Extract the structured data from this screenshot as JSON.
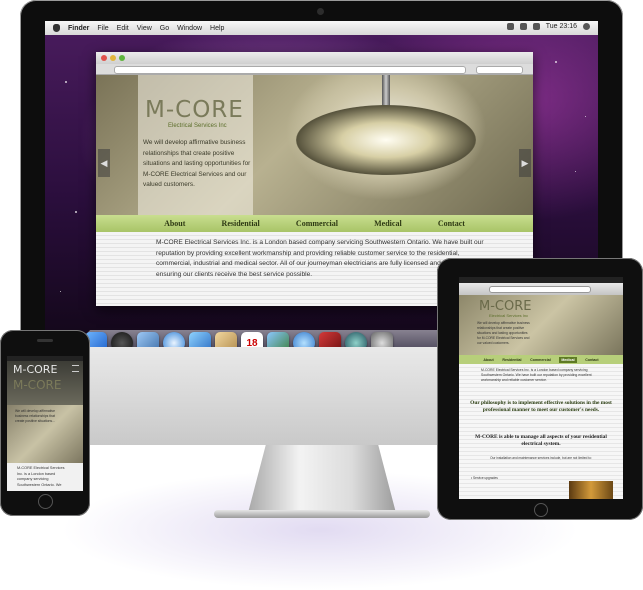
{
  "menubar": {
    "app": "Finder",
    "items": [
      "File",
      "Edit",
      "View",
      "Go",
      "Window",
      "Help"
    ],
    "clock": "Tue 23:16"
  },
  "site": {
    "logo": "M-CORE",
    "logo_subtitle": "Electrical Services Inc",
    "hero_text": "We will develop affirmative business relationships that create positive situations and lasting opportunities for M-CORE Electrical Services and our valued customers.",
    "nav": [
      "About",
      "Residential",
      "Commercial",
      "Medical",
      "Contact"
    ],
    "intro": "M-CORE Electrical Services Inc. is a London based company servicing Southwestern Ontario. We have built our reputation by providing excellent workmanship and providing reliable customer service to the residential, commercial, industrial and medical sector. All of our journeyman electricians are fully licensed and insured, ensuring our clients receive the best service possible."
  },
  "ipad": {
    "active_nav": "Medical",
    "intro_short": "M-CORE Electrical Services Inc. is a London based company servicing Southwestern Ontario. We have built our reputation by providing excellent workmanship and reliable customer service.",
    "philosophy": "Our philosophy is to implement effective solutions in the most professional manner to meet our customer's needs.",
    "ability": "M-CORE is able to manage all aspects of your residential electrical system.",
    "services_note": "Our installation and maintenance services include, but are not limited to:",
    "service_item": "• Service upgrades"
  },
  "iphone": {
    "hero_text": "We will develop affirmative business relationships that create positive situations...",
    "intro": "M-CORE Electrical Services Inc. is a London based company servicing Southwestern Ontario. We"
  },
  "colors": {
    "accent_green": "#a8c467",
    "dark_green": "#2e3a14",
    "wallpaper_purple": "#4a1c5e"
  },
  "icons": {
    "dock": [
      "finder-icon",
      "dashboard-icon",
      "preview-icon",
      "safari-icon",
      "facetime-icon",
      "mail-icon",
      "calendar-icon",
      "iphoto-icon",
      "itunes-icon",
      "photo-booth-icon",
      "time-machine-icon",
      "system-preferences-icon"
    ],
    "calendar_day": "18"
  }
}
